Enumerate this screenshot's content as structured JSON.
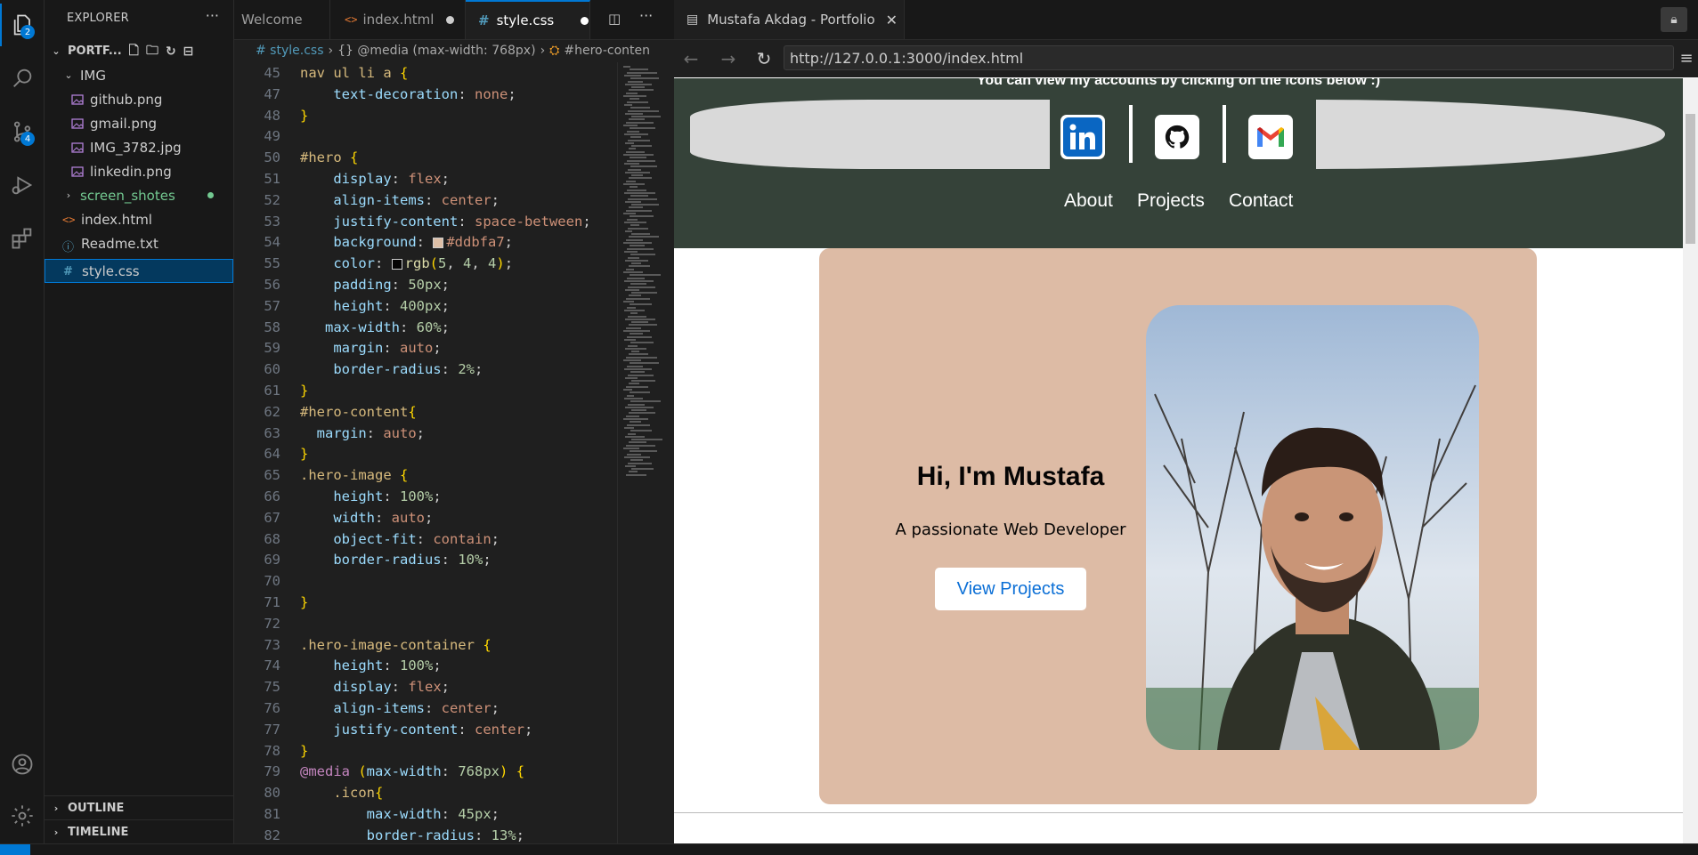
{
  "activity": {
    "explorer_badge": "2",
    "scm_badge": "4"
  },
  "sidebar": {
    "title": "EXPLORER",
    "more": "···",
    "project": "PORTF...",
    "tree": [
      {
        "label": "IMG",
        "type": "folder-open",
        "indent": 1
      },
      {
        "label": "github.png",
        "type": "image",
        "indent": 2
      },
      {
        "label": "gmail.png",
        "type": "image",
        "indent": 2
      },
      {
        "label": "IMG_3782.jpg",
        "type": "image",
        "indent": 2
      },
      {
        "label": "linkedin.png",
        "type": "image",
        "indent": 2
      },
      {
        "label": "screen_shotes",
        "type": "folder",
        "indent": 1
      },
      {
        "label": "index.html",
        "type": "html",
        "indent": 1
      },
      {
        "label": "Readme.txt",
        "type": "info",
        "indent": 1
      },
      {
        "label": "style.css",
        "type": "css",
        "indent": 1
      }
    ],
    "outline": "OUTLINE",
    "timeline": "TIMELINE"
  },
  "editor": {
    "tabs": [
      {
        "label": "Welcome"
      },
      {
        "label": "index.html"
      },
      {
        "label": "style.css"
      }
    ],
    "breadcrumb": [
      "# style.css",
      "›",
      "{} @media (max-width: 768px)",
      "›",
      "#hero-conten"
    ],
    "code_lines": [
      {
        "n": "45",
        "html": "<span class='sel'>nav ul li a </span><span class='brk'>{</span>"
      },
      {
        "n": "47",
        "html": "    <span class='prop'>text-decoration</span><span class='pun'>: </span><span class='val'>none</span><span class='pun'>;</span>"
      },
      {
        "n": "48",
        "html": "<span class='brk'>}</span>"
      },
      {
        "n": "49",
        "html": ""
      },
      {
        "n": "50",
        "html": "<span class='sel'>#hero </span><span class='brk'>{</span>"
      },
      {
        "n": "51",
        "html": "    <span class='prop'>display</span><span class='pun'>: </span><span class='val'>flex</span><span class='pun'>;</span>"
      },
      {
        "n": "52",
        "html": "    <span class='prop'>align-items</span><span class='pun'>: </span><span class='val'>center</span><span class='pun'>;</span>"
      },
      {
        "n": "53",
        "html": "    <span class='prop'>justify-content</span><span class='pun'>: </span><span class='val'>space-between</span><span class='pun'>;</span>"
      },
      {
        "n": "54",
        "html": "    <span class='prop'>background</span><span class='pun'>: </span><span class='swatch' style='background:#ddbfa7'></span><span class='val'>#ddbfa7</span><span class='pun'>;</span>"
      },
      {
        "n": "55",
        "html": "    <span class='prop'>color</span><span class='pun'>: </span><span class='swatch' style='background:#050404'></span><span class='fn'>rgb</span><span class='brk'>(</span><span class='num'>5</span><span class='pun'>, </span><span class='num'>4</span><span class='pun'>, </span><span class='num'>4</span><span class='brk'>)</span><span class='pun'>;</span>"
      },
      {
        "n": "56",
        "html": "    <span class='prop'>padding</span><span class='pun'>: </span><span class='num'>50px</span><span class='pun'>;</span>"
      },
      {
        "n": "57",
        "html": "    <span class='prop'>height</span><span class='pun'>: </span><span class='num'>400px</span><span class='pun'>;</span>"
      },
      {
        "n": "58",
        "html": "   <span class='prop'>max-width</span><span class='pun'>: </span><span class='num'>60%</span><span class='pun'>;</span>"
      },
      {
        "n": "59",
        "html": "    <span class='prop'>margin</span><span class='pun'>: </span><span class='val'>auto</span><span class='pun'>;</span>"
      },
      {
        "n": "60",
        "html": "    <span class='prop'>border-radius</span><span class='pun'>: </span><span class='num'>2%</span><span class='pun'>;</span>"
      },
      {
        "n": "61",
        "html": "<span class='brk'>}</span>"
      },
      {
        "n": "62",
        "html": "<span class='sel'>#hero-content</span><span class='brk'>{</span>"
      },
      {
        "n": "63",
        "html": "  <span class='prop'>margin</span><span class='pun'>: </span><span class='val'>auto</span><span class='pun'>;</span>"
      },
      {
        "n": "64",
        "html": "<span class='brk'>}</span>"
      },
      {
        "n": "65",
        "html": "<span class='sel'>.hero-image </span><span class='brk'>{</span>"
      },
      {
        "n": "66",
        "html": "    <span class='prop'>height</span><span class='pun'>: </span><span class='num'>100%</span><span class='pun'>;</span>"
      },
      {
        "n": "67",
        "html": "    <span class='prop'>width</span><span class='pun'>: </span><span class='val'>auto</span><span class='pun'>;</span>"
      },
      {
        "n": "68",
        "html": "    <span class='prop'>object-fit</span><span class='pun'>: </span><span class='val'>contain</span><span class='pun'>;</span>"
      },
      {
        "n": "69",
        "html": "    <span class='prop'>border-radius</span><span class='pun'>: </span><span class='num'>10%</span><span class='pun'>;</span>"
      },
      {
        "n": "70",
        "html": ""
      },
      {
        "n": "71",
        "html": "<span class='brk'>}</span>"
      },
      {
        "n": "72",
        "html": ""
      },
      {
        "n": "73",
        "html": "<span class='sel'>.hero-image-container </span><span class='brk'>{</span>"
      },
      {
        "n": "74",
        "html": "    <span class='prop'>height</span><span class='pun'>: </span><span class='num'>100%</span><span class='pun'>;</span>"
      },
      {
        "n": "75",
        "html": "    <span class='prop'>display</span><span class='pun'>: </span><span class='val'>flex</span><span class='pun'>;</span>"
      },
      {
        "n": "76",
        "html": "    <span class='prop'>align-items</span><span class='pun'>: </span><span class='val'>center</span><span class='pun'>;</span>"
      },
      {
        "n": "77",
        "html": "    <span class='prop'>justify-content</span><span class='pun'>: </span><span class='val'>center</span><span class='pun'>;</span>"
      },
      {
        "n": "78",
        "html": "<span class='brk'>}</span>"
      },
      {
        "n": "79",
        "html": "<span class='kw'>@media </span><span class='brk'>(</span><span class='prop'>max-width</span><span class='pun'>: </span><span class='num'>768px</span><span class='brk'>)</span><span class='pun'> </span><span class='brk'>{</span>"
      },
      {
        "n": "80",
        "html": "    <span class='sel'>.icon</span><span class='brk'>{</span>"
      },
      {
        "n": "81",
        "html": "        <span class='prop'>max-width</span><span class='pun'>: </span><span class='num'>45px</span><span class='pun'>;</span>"
      },
      {
        "n": "82",
        "html": "        <span class='prop'>border-radius</span><span class='pun'>: </span><span class='num'>13%</span><span class='pun'>;</span>"
      }
    ]
  },
  "browser": {
    "tab_title": "Mustafa Akdag - Portfolio",
    "url": "http://127.0.0.1:3000/index.html",
    "page": {
      "header_note": "You can view my accounts by clicking on the icons below :)",
      "nav": [
        "About",
        "Projects",
        "Contact"
      ],
      "hero_title": "Hi, I'm Mustafa",
      "hero_subtitle": "A passionate Web Developer",
      "hero_button": "View Projects"
    }
  },
  "colors": {
    "accent": "#0078d4",
    "header_bg": "#354239",
    "hero_bg": "#ddbba5",
    "button_text": "#0b6fd6"
  }
}
